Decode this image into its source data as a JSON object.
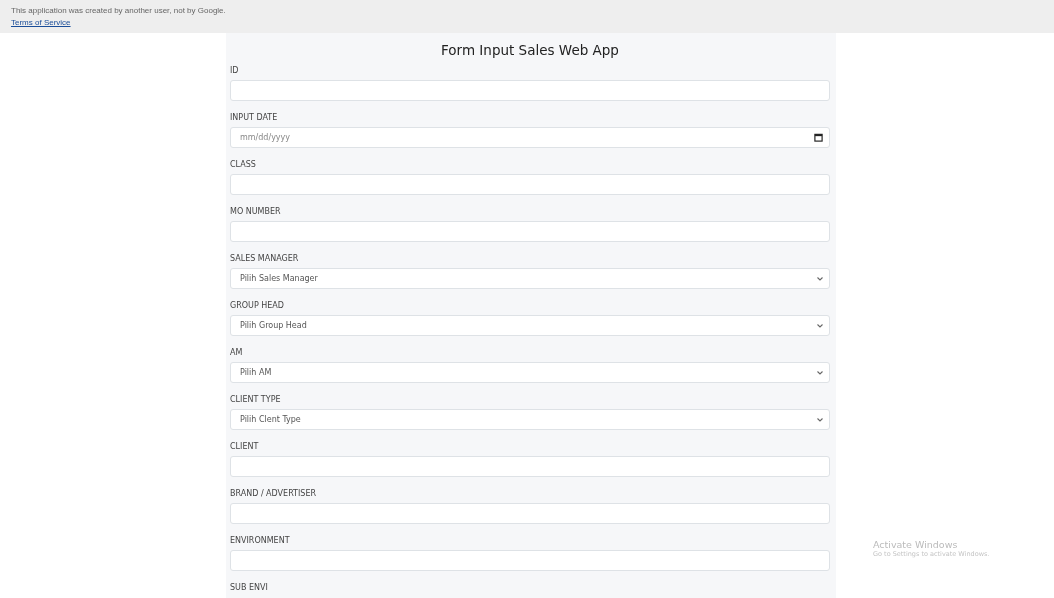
{
  "banner": {
    "notice": "This application was created by another user, not by Google.",
    "link": "Terms of Service"
  },
  "form": {
    "title": "Form Input Sales Web App",
    "fields": [
      {
        "kind": "text",
        "label": "ID"
      },
      {
        "kind": "date",
        "label": "INPUT DATE",
        "placeholder": "mm/dd/yyyy"
      },
      {
        "kind": "text",
        "label": "CLASS"
      },
      {
        "kind": "text",
        "label": "MO NUMBER"
      },
      {
        "kind": "select",
        "label": "SALES MANAGER",
        "placeholder": "Pilih Sales Manager"
      },
      {
        "kind": "select",
        "label": "GROUP HEAD",
        "placeholder": "Pilih Group Head"
      },
      {
        "kind": "select",
        "label": "AM",
        "placeholder": "Pilih AM"
      },
      {
        "kind": "select",
        "label": "CLIENT TYPE",
        "placeholder": "Pilih Clent Type"
      },
      {
        "kind": "text",
        "label": "CLIENT"
      },
      {
        "kind": "text",
        "label": "BRAND / ADVERTISER"
      },
      {
        "kind": "text",
        "label": "ENVIRONMENT"
      },
      {
        "kind": "label",
        "label": "SUB ENVI"
      }
    ]
  },
  "os_notice": {
    "title": "Activate Windows",
    "subtitle": "Go to Settings to activate Windows."
  }
}
